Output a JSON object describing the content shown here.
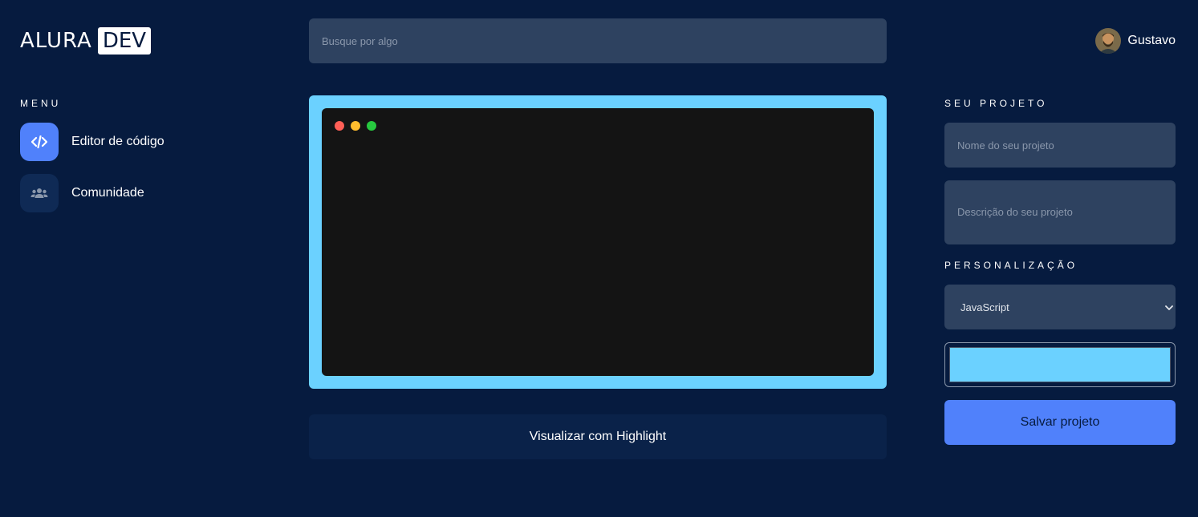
{
  "header": {
    "logo_text": "ALURA",
    "logo_box_text": "DEV",
    "search_placeholder": "Busque por algo",
    "user_name": "Gustavo"
  },
  "menu": {
    "title": "MENU",
    "items": [
      {
        "label": "Editor de código",
        "icon": "code-icon",
        "active": true
      },
      {
        "label": "Comunidade",
        "icon": "users-icon",
        "active": false
      }
    ]
  },
  "editor": {
    "window_dots": [
      "close-dot",
      "minimize-dot",
      "maximize-dot"
    ],
    "highlight_button_label": "Visualizar com Highlight"
  },
  "project": {
    "title": "SEU PROJETO",
    "name_placeholder": "Nome do seu projeto",
    "description_placeholder": "Descrição do seu projeto"
  },
  "customization": {
    "title": "PERSONALIZAÇÃO",
    "language_selected": "JavaScript",
    "color_value": "#6bd1ff",
    "save_button_label": "Salvar projeto"
  },
  "colors": {
    "background": "#061b3f",
    "accent": "#5081fb",
    "editor_border": "#6bd1ff",
    "editor_bg": "#141414",
    "dot_red": "#ff5f56",
    "dot_yellow": "#ffbd2e",
    "dot_green": "#27c93f",
    "menu_inactive": "#0f2a55"
  }
}
